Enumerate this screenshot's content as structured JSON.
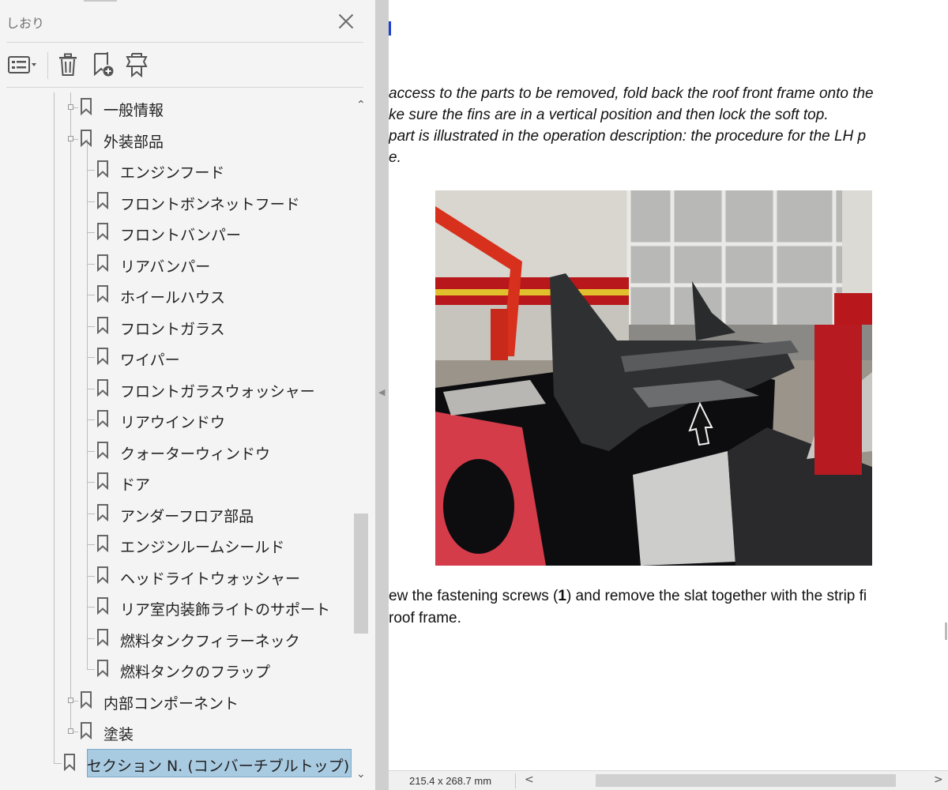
{
  "panel": {
    "title": "しおり",
    "toolbar": {
      "options_icon": "list-options-icon",
      "delete_icon": "trash-icon",
      "new_bookmark_icon": "bookmark-add-icon",
      "tag_icon": "bookmark-tag-icon"
    }
  },
  "bookmarks": [
    {
      "label": "一般情報",
      "level": 1,
      "expandable": true
    },
    {
      "label": "外装部品",
      "level": 1,
      "expandable": true
    },
    {
      "label": "エンジンフード",
      "level": 2
    },
    {
      "label": "フロントボンネットフード",
      "level": 2
    },
    {
      "label": "フロントバンパー",
      "level": 2
    },
    {
      "label": "リアバンパー",
      "level": 2
    },
    {
      "label": "ホイールハウス",
      "level": 2
    },
    {
      "label": "フロントガラス",
      "level": 2
    },
    {
      "label": "ワイパー",
      "level": 2
    },
    {
      "label": "フロントガラスウォッシャー",
      "level": 2
    },
    {
      "label": "リアウインドウ",
      "level": 2
    },
    {
      "label": "クォーターウィンドウ",
      "level": 2
    },
    {
      "label": "ドア",
      "level": 2
    },
    {
      "label": "アンダーフロア部品",
      "level": 2
    },
    {
      "label": "エンジンルームシールド",
      "level": 2
    },
    {
      "label": "ヘッドライトウォッシャー",
      "level": 2
    },
    {
      "label": "リア室内装飾ライトのサポート",
      "level": 2
    },
    {
      "label": "燃料タンクフィラーネック",
      "level": 2
    },
    {
      "label": "燃料タンクのフラップ",
      "level": 2
    },
    {
      "label": "内部コンポーネント",
      "level": 1,
      "expandable": true
    },
    {
      "label": "塗装",
      "level": 1,
      "expandable": true
    },
    {
      "label": "セクション N. (コンバーチブルトップ)",
      "level": 0,
      "selected": true
    }
  ],
  "document": {
    "para1": [
      "access to the parts to be removed, fold back the roof front frame onto the",
      "ke sure the fins are in a vertical position and then lock the soft top.",
      "part is illustrated in the operation description: the procedure for the LH p",
      "e."
    ],
    "para2_line1_pre": "ew the fastening screws (",
    "para2_line1_bold": "1",
    "para2_line1_post": ") and remove the slat together with the strip fi",
    "para2_line2": "roof frame."
  },
  "statusbar": {
    "page_size": "215.4 x 268.7 mm"
  },
  "colors": {
    "panel_bg": "#f4f4f4",
    "selection": "#a9cbe2",
    "splitter": "#cfcfcf"
  }
}
